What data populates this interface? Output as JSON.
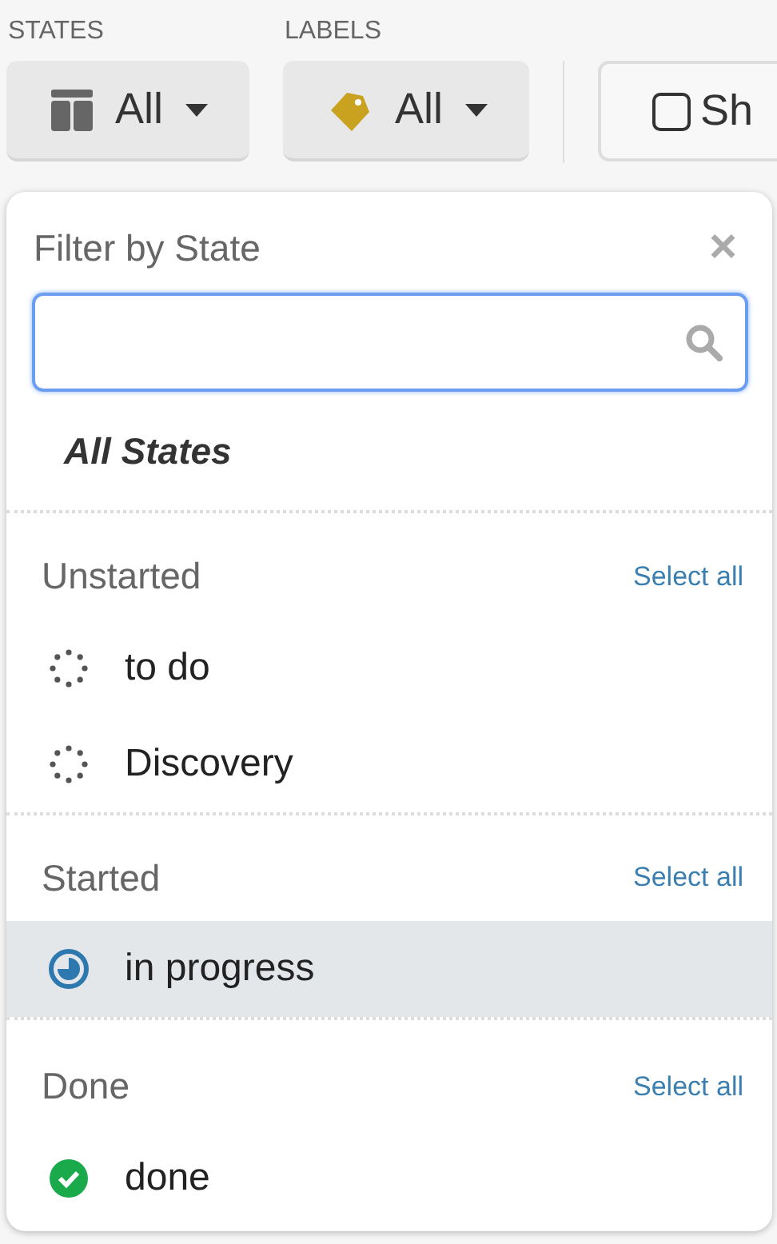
{
  "toolbar": {
    "groups": [
      {
        "heading": "STATES",
        "kind": "states",
        "value": "All"
      },
      {
        "heading": "LABELS",
        "kind": "labels",
        "value": "All"
      }
    ],
    "extra_button": {
      "label": "Sh",
      "checked": false
    }
  },
  "popover": {
    "title": "Filter by State",
    "close": "×",
    "all_option": "All States",
    "sections": [
      {
        "heading": "Unstarted",
        "action": "Select all",
        "items": [
          {
            "label": "to do",
            "kind": "unstarted",
            "selected": false
          },
          {
            "label": "Discovery",
            "kind": "unstarted",
            "selected": false
          }
        ]
      },
      {
        "heading": "Started",
        "action": "Select all",
        "items": [
          {
            "label": "in progress",
            "kind": "started",
            "selected": true
          }
        ]
      },
      {
        "heading": "Done",
        "action": "Select all",
        "items": [
          {
            "label": "done",
            "kind": "done",
            "selected": false
          }
        ]
      }
    ]
  }
}
